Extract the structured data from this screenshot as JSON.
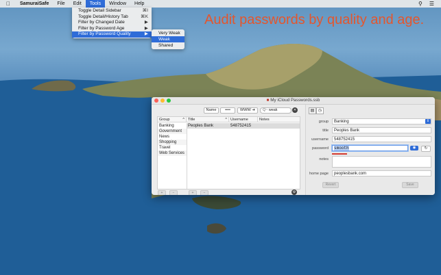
{
  "menubar": {
    "apple_icon": "apple-icon",
    "app_name": "SamuraiSafe",
    "items": [
      "File",
      "Edit",
      "Tools",
      "Window",
      "Help"
    ],
    "active": "Tools",
    "right_icons": [
      "search-icon",
      "list-icon"
    ]
  },
  "tools_menu": {
    "items": [
      {
        "label": "Toggle Detail Sidebar",
        "shortcut": "⌘I"
      },
      {
        "label": "Toggle Detail/History Tab",
        "shortcut": "⌘K"
      },
      {
        "label": "Filter by Changed Date",
        "shortcut": "▶"
      },
      {
        "label": "Filter by Password Age",
        "shortcut": "▶"
      },
      {
        "label": "Filter by Password Quality",
        "shortcut": "▶"
      }
    ]
  },
  "quality_submenu": {
    "items": [
      "Very Weak",
      "Weak",
      "Shared"
    ],
    "selected": "Weak"
  },
  "caption": "Audit passwords by quality and age.",
  "window": {
    "title": "My iCloud Passwords.ssb",
    "toolbar": {
      "name_button": "Name",
      "password_button": "••••",
      "www_button": "WWW",
      "search_value": "weak",
      "search_placeholder_icon": "Q~"
    },
    "table": {
      "headers": {
        "group": "Group",
        "title": "Title",
        "username": "Username",
        "notes": "Notes"
      },
      "groups": [
        "Banking",
        "Government",
        "News",
        "Shopping",
        "Travel",
        "Web Services"
      ],
      "rows": [
        {
          "title": "Peoples Bank",
          "username": "548752415",
          "notes": ""
        }
      ]
    },
    "bottom_buttons": [
      "+",
      "−",
      "+",
      "−"
    ],
    "detail": {
      "tabs": [
        "detail-tab-icon",
        "history-tab-icon"
      ],
      "labels": {
        "group": "group",
        "title": "title",
        "username": "username",
        "password": "password",
        "notes": "notes",
        "home_page": "home page"
      },
      "values": {
        "group": "Banking",
        "title": "Peoples Bank",
        "username": "548752415",
        "password": "smooth",
        "notes": "",
        "home_page": "peoplesbank.com"
      },
      "password_strength_color": "#d43a2f",
      "revert_button": "Revert",
      "save_button": "Save"
    }
  },
  "colors": {
    "accent": "#2f6cd8",
    "caption": "#e4562d"
  }
}
